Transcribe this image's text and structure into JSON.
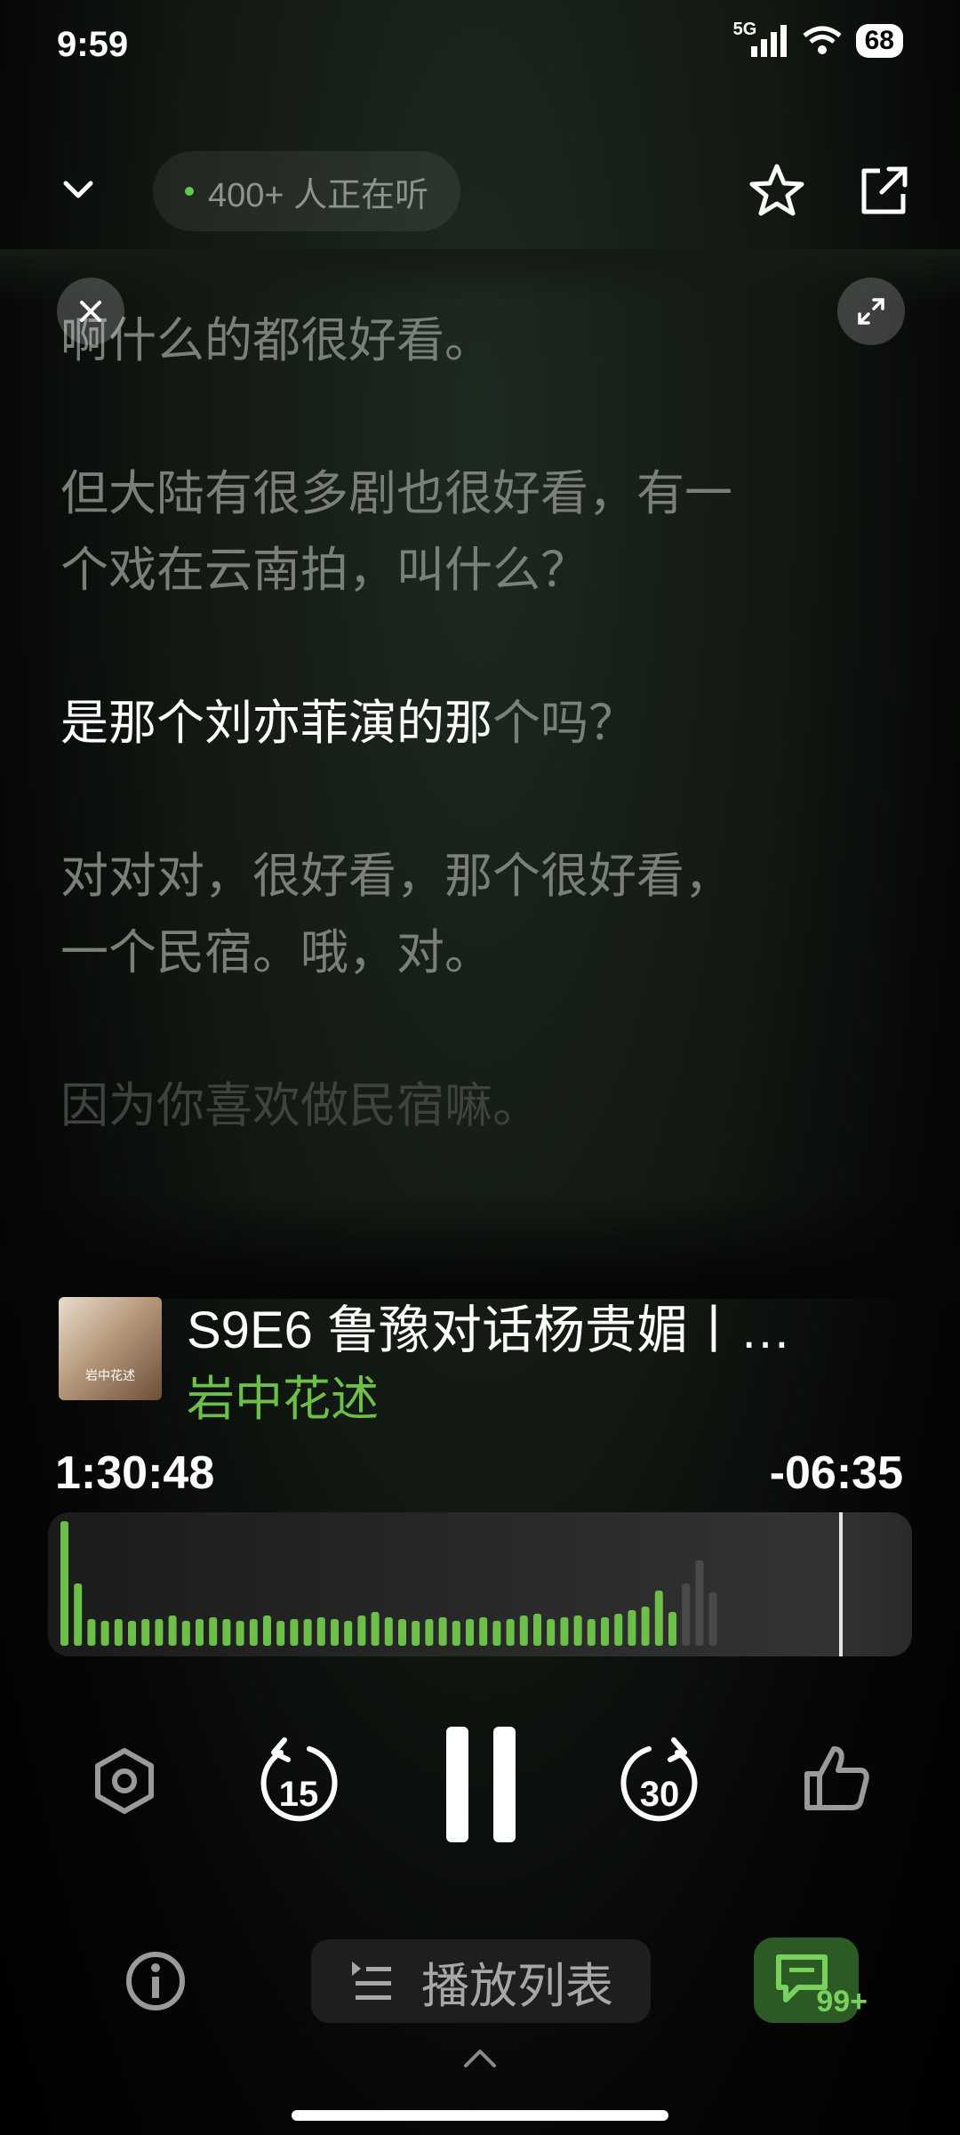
{
  "status": {
    "time": "9:59",
    "network": "5G",
    "battery": "68"
  },
  "header": {
    "listeners": "400+ 人正在听"
  },
  "transcript": {
    "partial_line": "啊什么的都很好看。",
    "para2": [
      "但大陆有很多剧也很好看，有一",
      "个戏在云南拍，叫什么？"
    ],
    "active": {
      "spoken": "是那个刘亦菲演的那",
      "upcoming": "个吗？"
    },
    "para4": [
      "对对对，很好看，那个很好看，",
      "一个民宿。哦，对。"
    ],
    "para5": "因为你喜欢做民宿嘛。"
  },
  "episode": {
    "title": "S9E6 鲁豫对话杨贵媚丨…",
    "show": "岩中花述",
    "cover_text": "岩中花述"
  },
  "player": {
    "elapsed": "1:30:48",
    "remaining": "-06:35",
    "skip_back": "15",
    "skip_forward": "30",
    "progress_fraction": 0.93,
    "played_color": "#6cc04a",
    "unplayed_color": "#4a4a4a"
  },
  "bottom": {
    "playlist_label": "播放列表",
    "comment_count": "99+"
  }
}
